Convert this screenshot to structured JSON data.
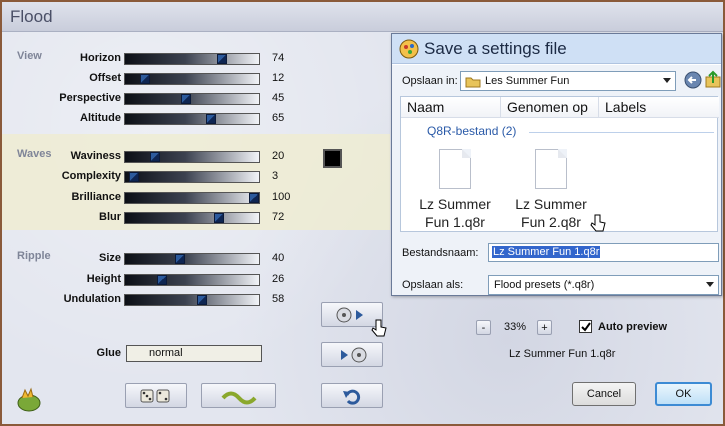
{
  "window": {
    "title": "Flood"
  },
  "sections": {
    "view": "View",
    "waves": "Waves",
    "ripple": "Ripple"
  },
  "sliders": [
    {
      "key": "horizon",
      "label": "Horizon",
      "value": 74,
      "max": 100
    },
    {
      "key": "offset",
      "label": "Offset",
      "value": 12,
      "max": 100
    },
    {
      "key": "perspective",
      "label": "Perspective",
      "value": 45,
      "max": 100
    },
    {
      "key": "altitude",
      "label": "Altitude",
      "value": 65,
      "max": 100
    },
    {
      "key": "waviness",
      "label": "Waviness",
      "value": 20,
      "max": 100
    },
    {
      "key": "complexity",
      "label": "Complexity",
      "value": 3,
      "max": 100
    },
    {
      "key": "brilliance",
      "label": "Brilliance",
      "value": 100,
      "max": 100
    },
    {
      "key": "blur",
      "label": "Blur",
      "value": 72,
      "max": 100
    },
    {
      "key": "size",
      "label": "Size",
      "value": 40,
      "max": 100
    },
    {
      "key": "height",
      "label": "Height",
      "value": 26,
      "max": 100
    },
    {
      "key": "undulation",
      "label": "Undulation",
      "value": 58,
      "max": 100
    }
  ],
  "glue": {
    "label": "Glue",
    "value": "normal"
  },
  "colors": {
    "wave_swatch": "#000000",
    "accent": "#2c5a9c"
  },
  "zoom": {
    "minus": "-",
    "value": "33%",
    "plus": "+"
  },
  "auto_preview": {
    "label": "Auto preview",
    "checked": true
  },
  "preset_name": "Lz Summer Fun 1.q8r",
  "buttons": {
    "cancel": "Cancel",
    "ok": "OK"
  },
  "dialog": {
    "title": "Save a settings file",
    "save_in_label": "Opslaan in:",
    "save_in_value": "Les Summer Fun",
    "columns": [
      "Naam",
      "Genomen op",
      "Labels"
    ],
    "group": "Q8R-bestand (2)",
    "files": [
      {
        "line1": "Lz Summer",
        "line2": "Fun 1.q8r"
      },
      {
        "line1": "Lz Summer",
        "line2": "Fun 2.q8r"
      }
    ],
    "filename_label": "Bestandsnaam:",
    "filename_value": "Lz Summer Fun 1.q8r",
    "savetype_label": "Opslaan als:",
    "savetype_value": "Flood presets (*.q8r)"
  },
  "icons": [
    "dice-icon",
    "wave-icon",
    "save-preset-icon",
    "load-preset-icon",
    "undo-icon",
    "app-logo-icon",
    "folder-icon",
    "back-icon",
    "folder-up-icon",
    "hand-cursor-icon"
  ]
}
